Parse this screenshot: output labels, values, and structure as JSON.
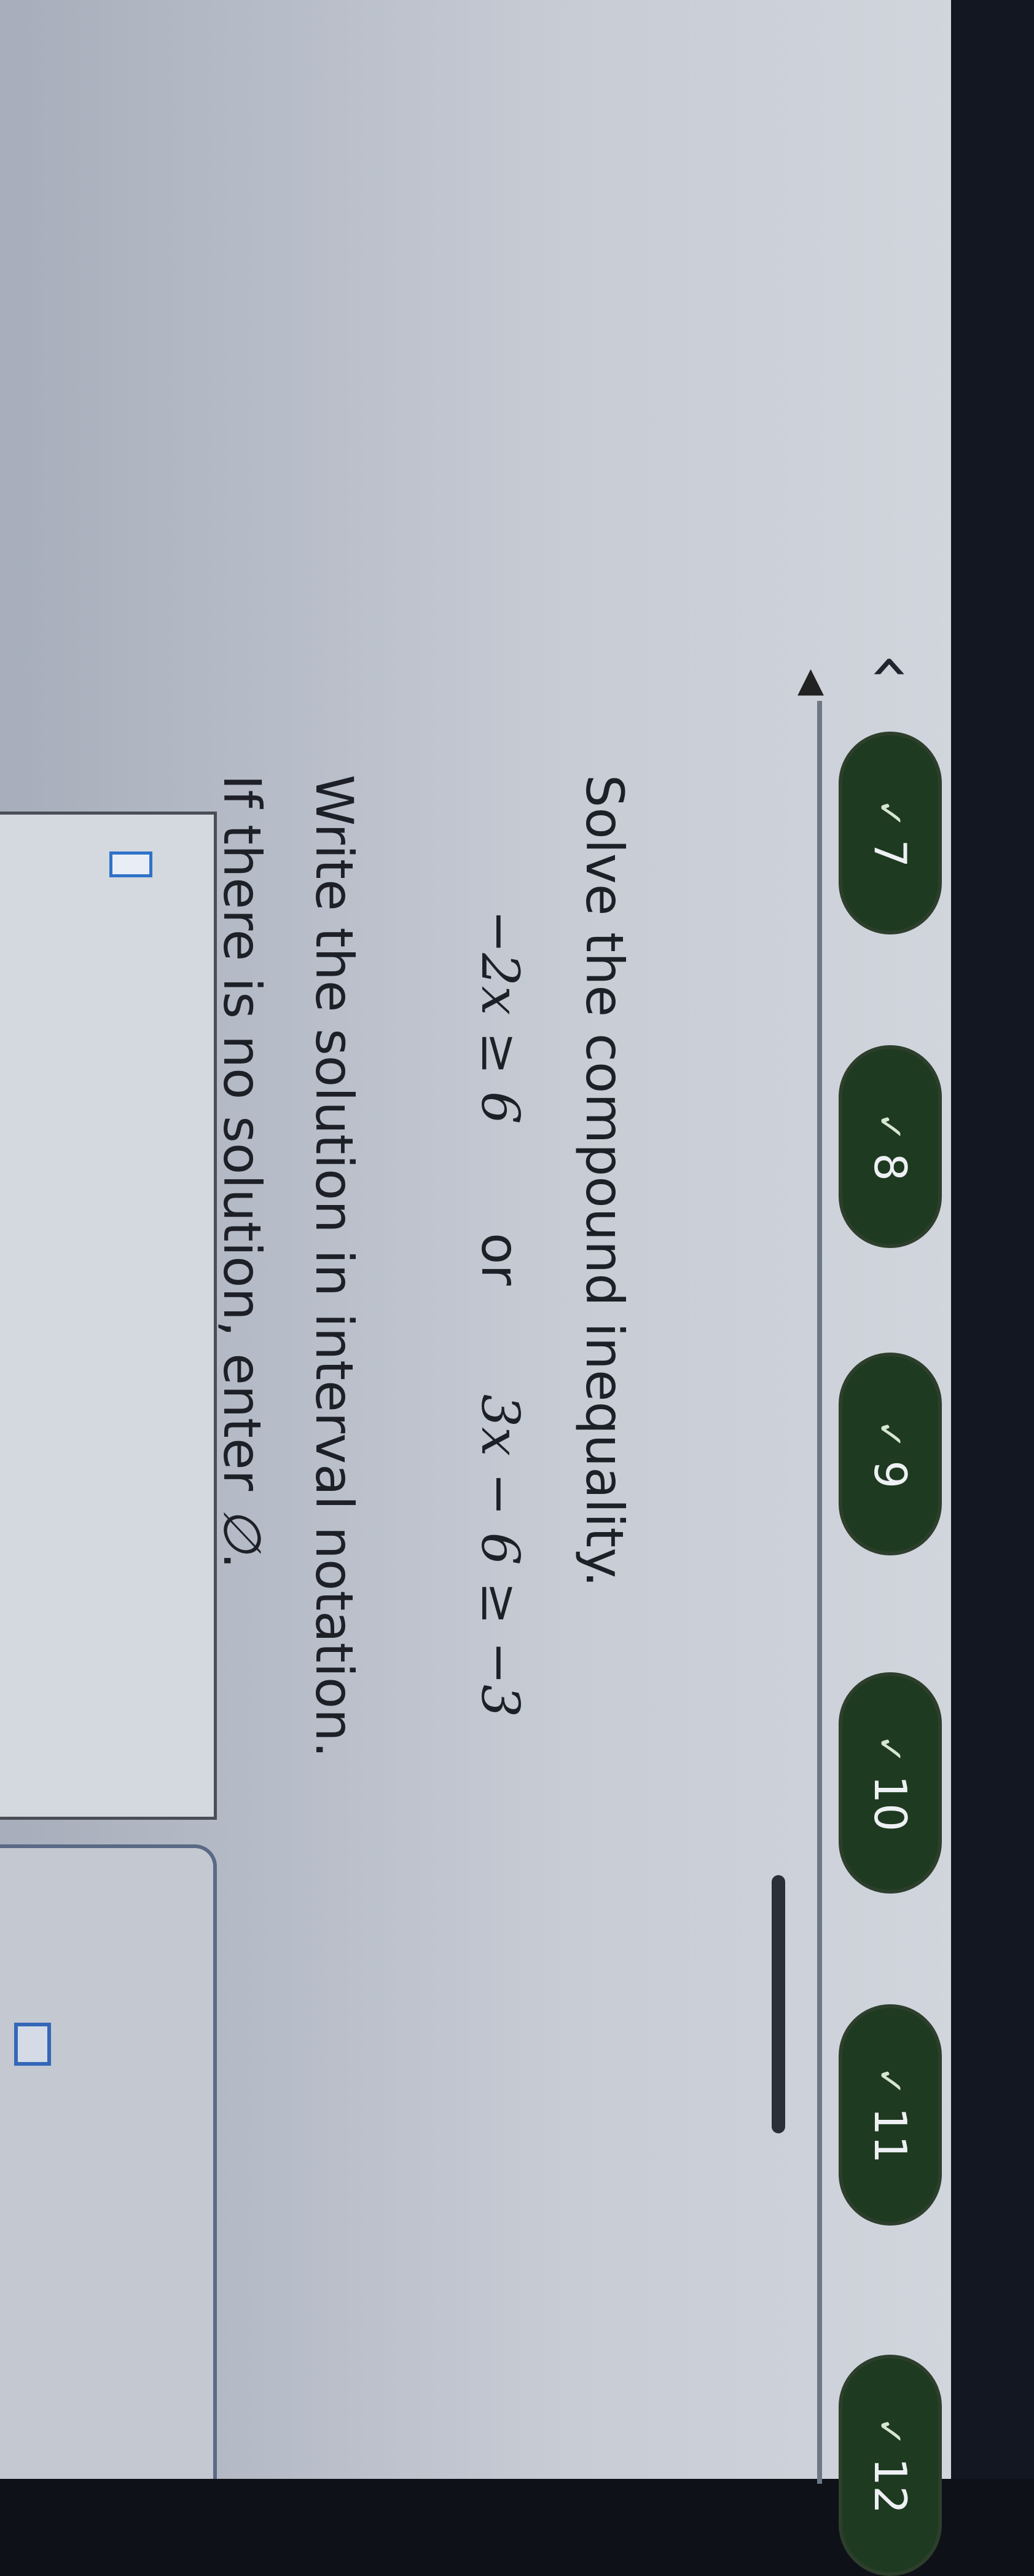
{
  "question_nav": {
    "back_icon": "chevron-left-icon",
    "items": [
      {
        "number": "7",
        "status": "answered",
        "check": "✓"
      },
      {
        "number": "8",
        "status": "answered",
        "check": "✓"
      },
      {
        "number": "9",
        "status": "answered",
        "check": "✓"
      },
      {
        "number": "10",
        "status": "answered",
        "check": "✓"
      },
      {
        "number": "11",
        "status": "answered",
        "check": "✓"
      },
      {
        "number": "12",
        "status": "answered",
        "check": "✓"
      }
    ],
    "pill_color": "#1e3a20"
  },
  "question": {
    "collapse_icon": "triangle-left-icon",
    "prompt": "Solve the compound inequality.",
    "inequality_left": "−2x ≥ 6",
    "connector": "or",
    "inequality_right": "3x − 6 ≥ −3",
    "instruction_1": "Write the solution in interval notation.",
    "instruction_2_prefix": "If there is no solution, enter ",
    "empty_set_symbol": "∅",
    "instruction_2_suffix": "."
  },
  "answer": {
    "value": "",
    "cursor_color": "#2f73c9"
  }
}
